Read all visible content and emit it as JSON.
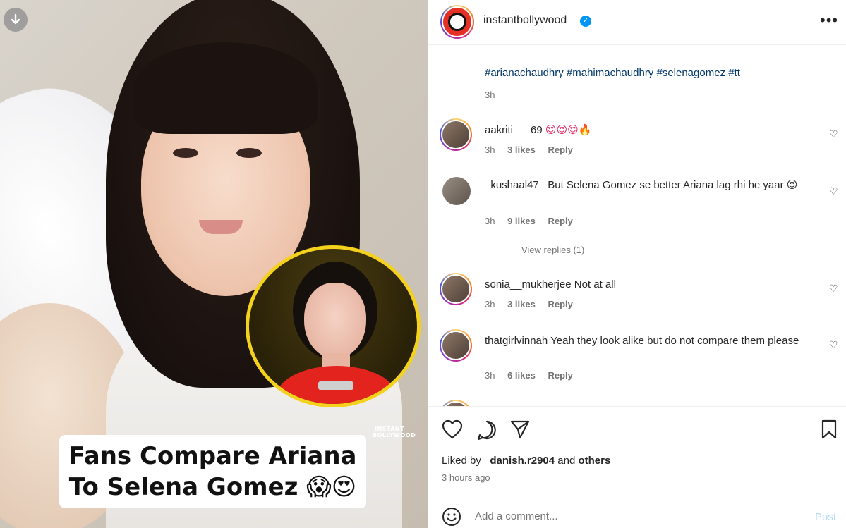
{
  "media": {
    "caption_line1": "Fans Compare Ariana",
    "caption_line2": "To Selena Gomez 😱😍",
    "watermark_line1": "INSTANT",
    "watermark_line2": "BOLLYWOOD",
    "download_icon": "download-arrow-icon"
  },
  "header": {
    "username": "instantbollywood",
    "verified_icon": "verified-badge-icon",
    "more_label": "•••"
  },
  "post": {
    "hashtags": "#arianachaudhry #mahimachaudhry #selenagomez #tt",
    "time": "3h"
  },
  "comments": [
    {
      "user": "aakriti___69",
      "text": "😍😍😍🔥",
      "time": "3h",
      "likes": "3 likes",
      "reply": "Reply"
    },
    {
      "user": "_kushaal47_",
      "text": "But Selena Gomez se better Ariana lag rhi he yaar 😍",
      "time": "3h",
      "likes": "9 likes",
      "reply": "Reply"
    },
    {
      "user": "sonia__mukherjee",
      "text": "Not at all",
      "time": "3h",
      "likes": "3 likes",
      "reply": "Reply"
    },
    {
      "user": "thatgirlvinnah",
      "text": "Yeah they look alike but do not compare them please",
      "time": "3h",
      "likes": "6 likes",
      "reply": "Reply"
    }
  ],
  "view_replies": "View replies (1)",
  "actions": {
    "liked_prefix": "Liked by",
    "liked_user": "_danish.r2904",
    "liked_and": "and",
    "liked_others": "others",
    "time_ago": "3 hours ago"
  },
  "add_comment": {
    "placeholder": "Add a comment...",
    "post_label": "Post"
  },
  "colors": {
    "link": "#00376b",
    "muted": "#737373",
    "verified": "#0095f6",
    "post_disabled": "#b3dbff",
    "caption_highlight": "#f3d11d"
  }
}
